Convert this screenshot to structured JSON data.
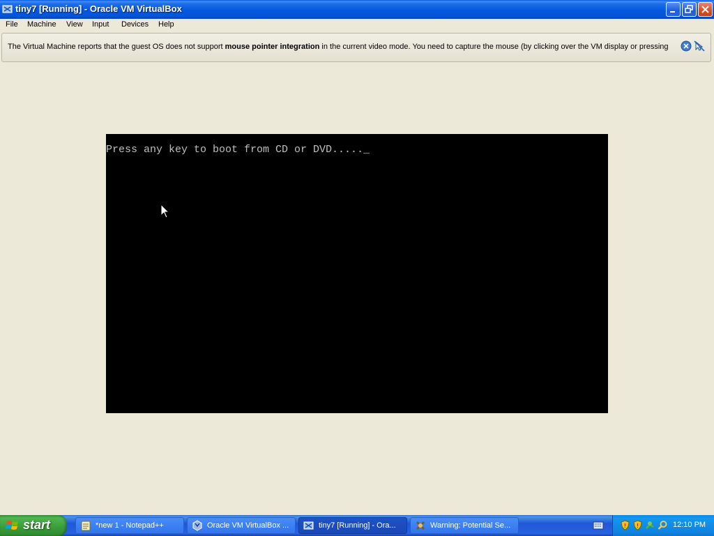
{
  "window": {
    "title": "tiny7 [Running] - Oracle VM VirtualBox"
  },
  "menu": [
    "File",
    "Machine",
    "View",
    "Input",
    "Devices",
    "Help"
  ],
  "notification": {
    "text_before": "The Virtual Machine reports that the guest OS does not support ",
    "text_bold": "mouse pointer integration",
    "text_after": " in the current video mode. You need to capture the mouse (by clicking over the VM display or pressing"
  },
  "vm": {
    "boot_message": "Press any key to boot from CD or DVD....._"
  },
  "taskbar": {
    "start_label": "start",
    "tasks": [
      {
        "label": "*new 1 - Notepad++",
        "icon": "notepad-plus-icon"
      },
      {
        "label": "Oracle VM VirtualBox ...",
        "icon": "virtualbox-icon"
      },
      {
        "label": "tiny7 [Running] - Ora...",
        "icon": "virtualbox-vm-icon"
      },
      {
        "label": "Warning: Potential Se...",
        "icon": "warning-app-icon"
      }
    ],
    "clock": "12:10 PM"
  },
  "colors": {
    "titlebar": "#0458DF",
    "taskbar": "#2157D7",
    "start": "#3A9B3A",
    "tray": "#0F84E0",
    "vm_text": "#BEBEBE"
  }
}
